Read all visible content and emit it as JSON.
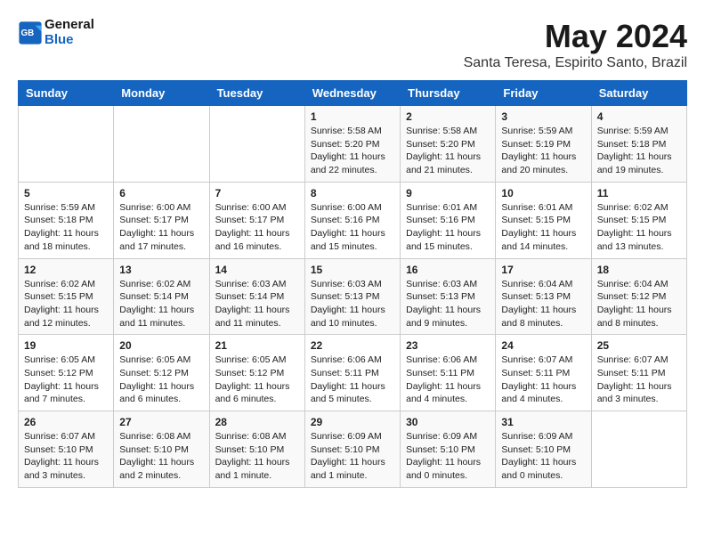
{
  "logo": {
    "line1": "General",
    "line2": "Blue"
  },
  "title": "May 2024",
  "location": "Santa Teresa, Espirito Santo, Brazil",
  "weekdays": [
    "Sunday",
    "Monday",
    "Tuesday",
    "Wednesday",
    "Thursday",
    "Friday",
    "Saturday"
  ],
  "weeks": [
    [
      {
        "day": "",
        "info": ""
      },
      {
        "day": "",
        "info": ""
      },
      {
        "day": "",
        "info": ""
      },
      {
        "day": "1",
        "info": "Sunrise: 5:58 AM\nSunset: 5:20 PM\nDaylight: 11 hours and 22 minutes."
      },
      {
        "day": "2",
        "info": "Sunrise: 5:58 AM\nSunset: 5:20 PM\nDaylight: 11 hours and 21 minutes."
      },
      {
        "day": "3",
        "info": "Sunrise: 5:59 AM\nSunset: 5:19 PM\nDaylight: 11 hours and 20 minutes."
      },
      {
        "day": "4",
        "info": "Sunrise: 5:59 AM\nSunset: 5:18 PM\nDaylight: 11 hours and 19 minutes."
      }
    ],
    [
      {
        "day": "5",
        "info": "Sunrise: 5:59 AM\nSunset: 5:18 PM\nDaylight: 11 hours and 18 minutes."
      },
      {
        "day": "6",
        "info": "Sunrise: 6:00 AM\nSunset: 5:17 PM\nDaylight: 11 hours and 17 minutes."
      },
      {
        "day": "7",
        "info": "Sunrise: 6:00 AM\nSunset: 5:17 PM\nDaylight: 11 hours and 16 minutes."
      },
      {
        "day": "8",
        "info": "Sunrise: 6:00 AM\nSunset: 5:16 PM\nDaylight: 11 hours and 15 minutes."
      },
      {
        "day": "9",
        "info": "Sunrise: 6:01 AM\nSunset: 5:16 PM\nDaylight: 11 hours and 15 minutes."
      },
      {
        "day": "10",
        "info": "Sunrise: 6:01 AM\nSunset: 5:15 PM\nDaylight: 11 hours and 14 minutes."
      },
      {
        "day": "11",
        "info": "Sunrise: 6:02 AM\nSunset: 5:15 PM\nDaylight: 11 hours and 13 minutes."
      }
    ],
    [
      {
        "day": "12",
        "info": "Sunrise: 6:02 AM\nSunset: 5:15 PM\nDaylight: 11 hours and 12 minutes."
      },
      {
        "day": "13",
        "info": "Sunrise: 6:02 AM\nSunset: 5:14 PM\nDaylight: 11 hours and 11 minutes."
      },
      {
        "day": "14",
        "info": "Sunrise: 6:03 AM\nSunset: 5:14 PM\nDaylight: 11 hours and 11 minutes."
      },
      {
        "day": "15",
        "info": "Sunrise: 6:03 AM\nSunset: 5:13 PM\nDaylight: 11 hours and 10 minutes."
      },
      {
        "day": "16",
        "info": "Sunrise: 6:03 AM\nSunset: 5:13 PM\nDaylight: 11 hours and 9 minutes."
      },
      {
        "day": "17",
        "info": "Sunrise: 6:04 AM\nSunset: 5:13 PM\nDaylight: 11 hours and 8 minutes."
      },
      {
        "day": "18",
        "info": "Sunrise: 6:04 AM\nSunset: 5:12 PM\nDaylight: 11 hours and 8 minutes."
      }
    ],
    [
      {
        "day": "19",
        "info": "Sunrise: 6:05 AM\nSunset: 5:12 PM\nDaylight: 11 hours and 7 minutes."
      },
      {
        "day": "20",
        "info": "Sunrise: 6:05 AM\nSunset: 5:12 PM\nDaylight: 11 hours and 6 minutes."
      },
      {
        "day": "21",
        "info": "Sunrise: 6:05 AM\nSunset: 5:12 PM\nDaylight: 11 hours and 6 minutes."
      },
      {
        "day": "22",
        "info": "Sunrise: 6:06 AM\nSunset: 5:11 PM\nDaylight: 11 hours and 5 minutes."
      },
      {
        "day": "23",
        "info": "Sunrise: 6:06 AM\nSunset: 5:11 PM\nDaylight: 11 hours and 4 minutes."
      },
      {
        "day": "24",
        "info": "Sunrise: 6:07 AM\nSunset: 5:11 PM\nDaylight: 11 hours and 4 minutes."
      },
      {
        "day": "25",
        "info": "Sunrise: 6:07 AM\nSunset: 5:11 PM\nDaylight: 11 hours and 3 minutes."
      }
    ],
    [
      {
        "day": "26",
        "info": "Sunrise: 6:07 AM\nSunset: 5:10 PM\nDaylight: 11 hours and 3 minutes."
      },
      {
        "day": "27",
        "info": "Sunrise: 6:08 AM\nSunset: 5:10 PM\nDaylight: 11 hours and 2 minutes."
      },
      {
        "day": "28",
        "info": "Sunrise: 6:08 AM\nSunset: 5:10 PM\nDaylight: 11 hours and 1 minute."
      },
      {
        "day": "29",
        "info": "Sunrise: 6:09 AM\nSunset: 5:10 PM\nDaylight: 11 hours and 1 minute."
      },
      {
        "day": "30",
        "info": "Sunrise: 6:09 AM\nSunset: 5:10 PM\nDaylight: 11 hours and 0 minutes."
      },
      {
        "day": "31",
        "info": "Sunrise: 6:09 AM\nSunset: 5:10 PM\nDaylight: 11 hours and 0 minutes."
      },
      {
        "day": "",
        "info": ""
      }
    ]
  ]
}
